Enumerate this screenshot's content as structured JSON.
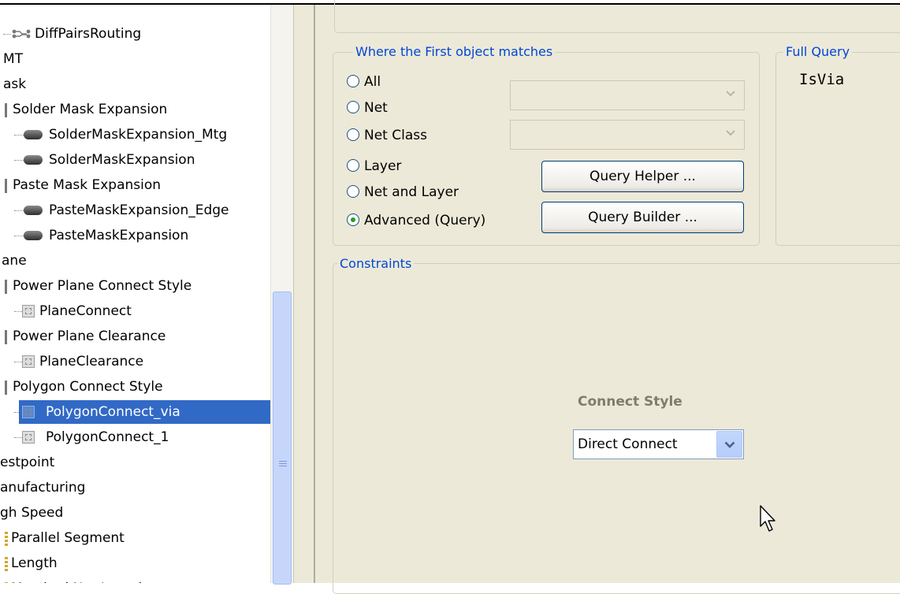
{
  "tree": {
    "rows": [
      {
        "label": "DiffPairsRouting",
        "icon": "diffpair-route-icon"
      },
      {
        "label": "MT",
        "icon": ""
      },
      {
        "label": "ask",
        "icon": ""
      },
      {
        "label": "Solder Mask Expansion",
        "icon": "rule-category-icon"
      },
      {
        "label": "SolderMaskExpansion_Mtg",
        "icon": "mask-rule-icon"
      },
      {
        "label": "SolderMaskExpansion",
        "icon": "mask-rule-icon"
      },
      {
        "label": "Paste Mask Expansion",
        "icon": "rule-category-icon"
      },
      {
        "label": "PasteMaskExpansion_Edge",
        "icon": "mask-rule-icon"
      },
      {
        "label": "PasteMaskExpansion",
        "icon": "mask-rule-icon"
      },
      {
        "label": "ane",
        "icon": ""
      },
      {
        "label": "Power Plane Connect Style",
        "icon": "rule-category-icon"
      },
      {
        "label": "PlaneConnect",
        "icon": "plane-rule-icon"
      },
      {
        "label": "Power Plane Clearance",
        "icon": "rule-category-icon"
      },
      {
        "label": "PlaneClearance",
        "icon": "plane-rule-icon"
      },
      {
        "label": "Polygon Connect Style",
        "icon": "rule-category-icon"
      },
      {
        "label": "PolygonConnect_via",
        "icon": "plane-rule-icon"
      },
      {
        "label": "PolygonConnect_1",
        "icon": "plane-rule-icon"
      },
      {
        "label": "estpoint",
        "icon": ""
      },
      {
        "label": "anufacturing",
        "icon": ""
      },
      {
        "label": "gh Speed",
        "icon": ""
      },
      {
        "label": "Parallel Segment",
        "icon": "highspeed-rule-icon"
      },
      {
        "label": "Length",
        "icon": "highspeed-rule-icon"
      },
      {
        "label": "Matched Net Lengths",
        "icon": "highspeed-rule-icon"
      }
    ],
    "selected": "PolygonConnect_via"
  },
  "where": {
    "legend": "Where the First object matches",
    "options": [
      {
        "label": "All",
        "checked": false
      },
      {
        "label": "Net",
        "checked": false
      },
      {
        "label": "Net Class",
        "checked": false
      },
      {
        "label": "Layer",
        "checked": false
      },
      {
        "label": "Net and Layer",
        "checked": false
      },
      {
        "label": "Advanced (Query)",
        "checked": true
      }
    ],
    "net_combo_value": "",
    "netclass_combo_value": "",
    "query_helper_label": "Query Helper ...",
    "query_builder_label": "Query Builder ..."
  },
  "full_query": {
    "legend": "Full Query",
    "text": "IsVia"
  },
  "constraints": {
    "legend": "Constraints",
    "connect_style_title": "Connect Style",
    "connect_style_value": "Direct Connect"
  },
  "colors": {
    "selection": "#3169c6",
    "panel_bg": "#ece9d8",
    "legend_text": "#0046d5"
  }
}
